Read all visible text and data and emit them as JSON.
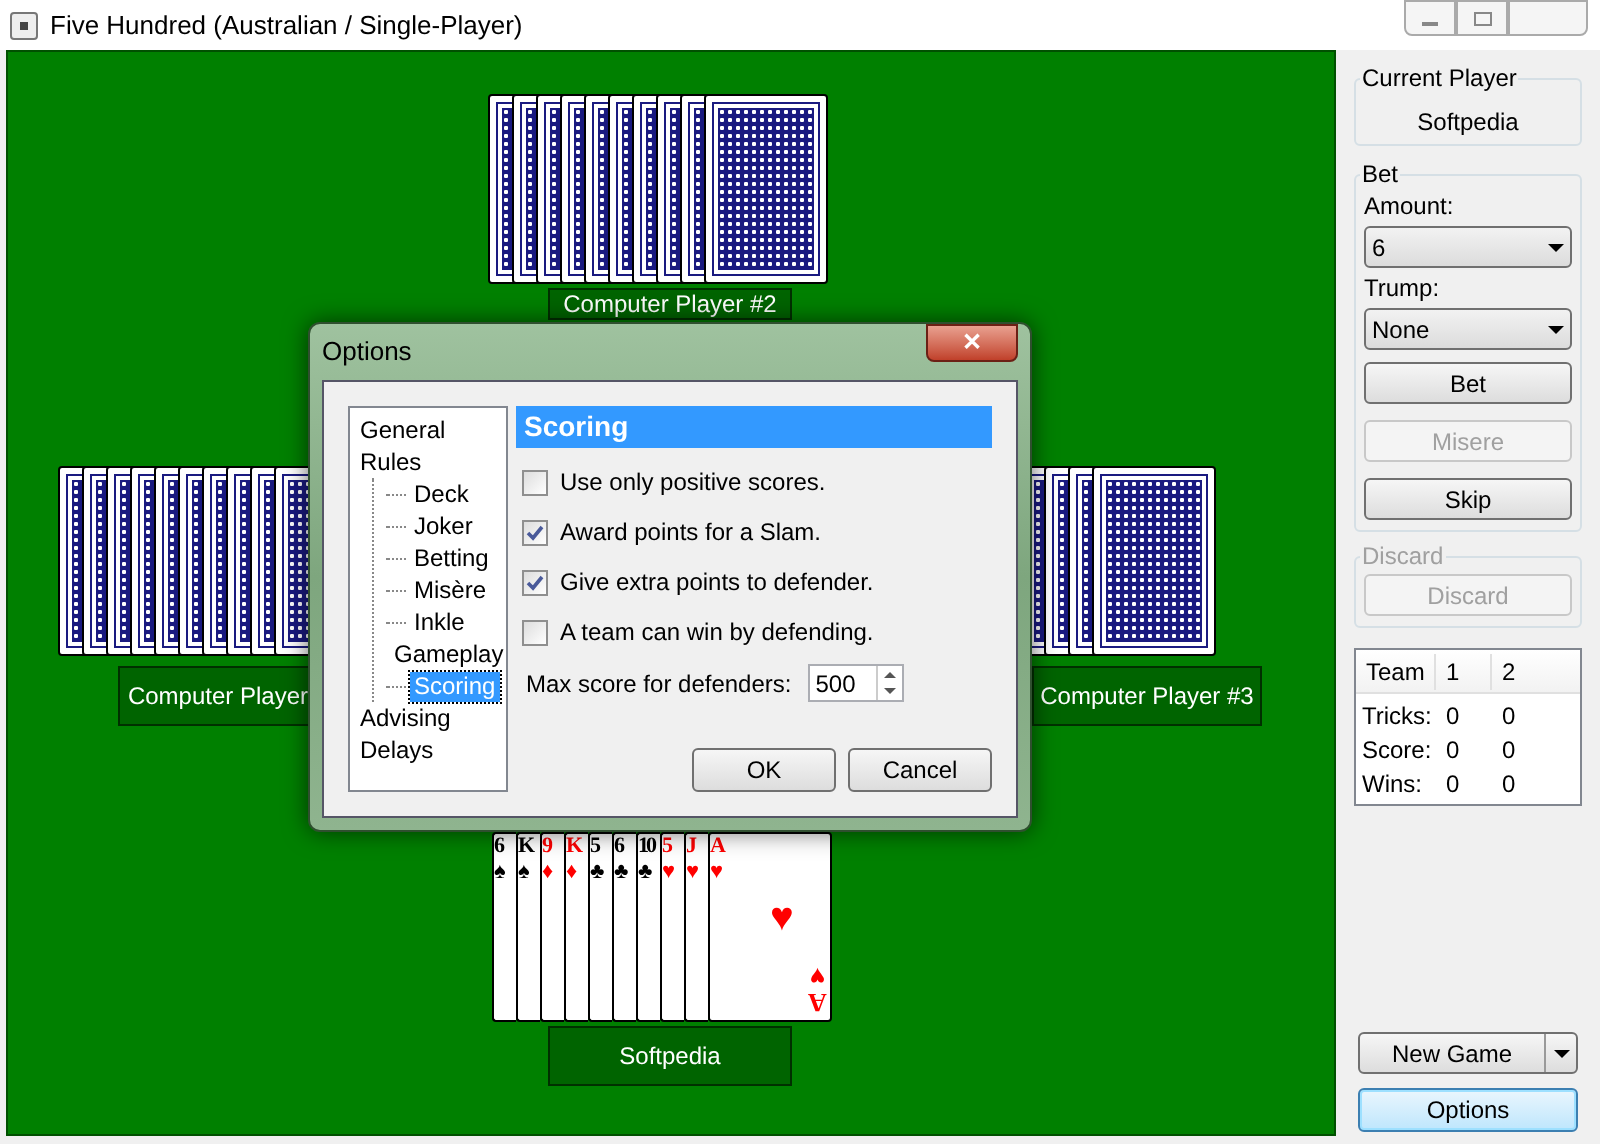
{
  "window": {
    "title": "Five Hundred (Australian / Single-Player)"
  },
  "table": {
    "players": [
      {
        "name": "Computer Player #2"
      },
      {
        "name": "Computer Player"
      },
      {
        "name": "Computer Player #3"
      },
      {
        "name": "Softpedia"
      }
    ],
    "hand": [
      {
        "rank": "6",
        "suit": "♠",
        "color": "#000000"
      },
      {
        "rank": "K",
        "suit": "♠",
        "color": "#000000"
      },
      {
        "rank": "9",
        "suit": "♦",
        "color": "#ff0000"
      },
      {
        "rank": "K",
        "suit": "♦",
        "color": "#ff0000"
      },
      {
        "rank": "5",
        "suit": "♣",
        "color": "#000000"
      },
      {
        "rank": "6",
        "suit": "♣",
        "color": "#000000"
      },
      {
        "rank": "10",
        "suit": "♣",
        "color": "#000000"
      },
      {
        "rank": "5",
        "suit": "♥",
        "color": "#ff0000"
      },
      {
        "rank": "J",
        "suit": "♥",
        "color": "#ff0000"
      },
      {
        "rank": "A",
        "suit": "♥",
        "color": "#ff0000",
        "center_suit": "♥",
        "bottom_rank": "A",
        "bottom_suit": "♥"
      }
    ]
  },
  "sidebar": {
    "current_player": {
      "label": "Current Player",
      "name": "Softpedia"
    },
    "bet": {
      "label": "Bet",
      "amount_label": "Amount:",
      "amount": "6",
      "trump_label": "Trump:",
      "trump": "None",
      "buttons": [
        {
          "label": "Bet",
          "disabled": false
        },
        {
          "label": "Misere",
          "disabled": true
        },
        {
          "label": "Skip",
          "disabled": false
        }
      ]
    },
    "discard": {
      "label": "Discard",
      "disabled": true,
      "button": "Discard"
    },
    "scores": {
      "columns": [
        "Team",
        "1",
        "2"
      ],
      "rows": [
        [
          "Tricks:",
          "0",
          "0"
        ],
        [
          "Score:",
          "0",
          "0"
        ],
        [
          "Wins:",
          "0",
          "0"
        ]
      ]
    },
    "new_game": "New Game",
    "options": "Options"
  },
  "dialog": {
    "title": "Options",
    "close": "✕",
    "tree": [
      {
        "label": "General",
        "selected": false
      },
      {
        "label": "Rules",
        "selected": false,
        "children": [
          {
            "label": "Deck",
            "selected": false
          },
          {
            "label": "Joker",
            "selected": false
          },
          {
            "label": "Betting",
            "selected": false
          },
          {
            "label": "Misère",
            "selected": false
          },
          {
            "label": "Inkle",
            "selected": false
          },
          {
            "label": "Gameplay",
            "selected": false
          },
          {
            "label": "Scoring",
            "selected": true
          }
        ]
      },
      {
        "label": "Advising",
        "selected": false
      },
      {
        "label": "Delays",
        "selected": false
      }
    ],
    "heading": "Scoring",
    "options": [
      {
        "label": "Use only positive scores.",
        "checked": false
      },
      {
        "label": "Award points for a Slam.",
        "checked": true
      },
      {
        "label": "Give extra points to defender.",
        "checked": true
      },
      {
        "label": "A team can win by defending.",
        "checked": false
      }
    ],
    "max_score": {
      "label": "Max score for defenders:",
      "value": "500"
    },
    "buttons": [
      "OK",
      "Cancel"
    ]
  }
}
